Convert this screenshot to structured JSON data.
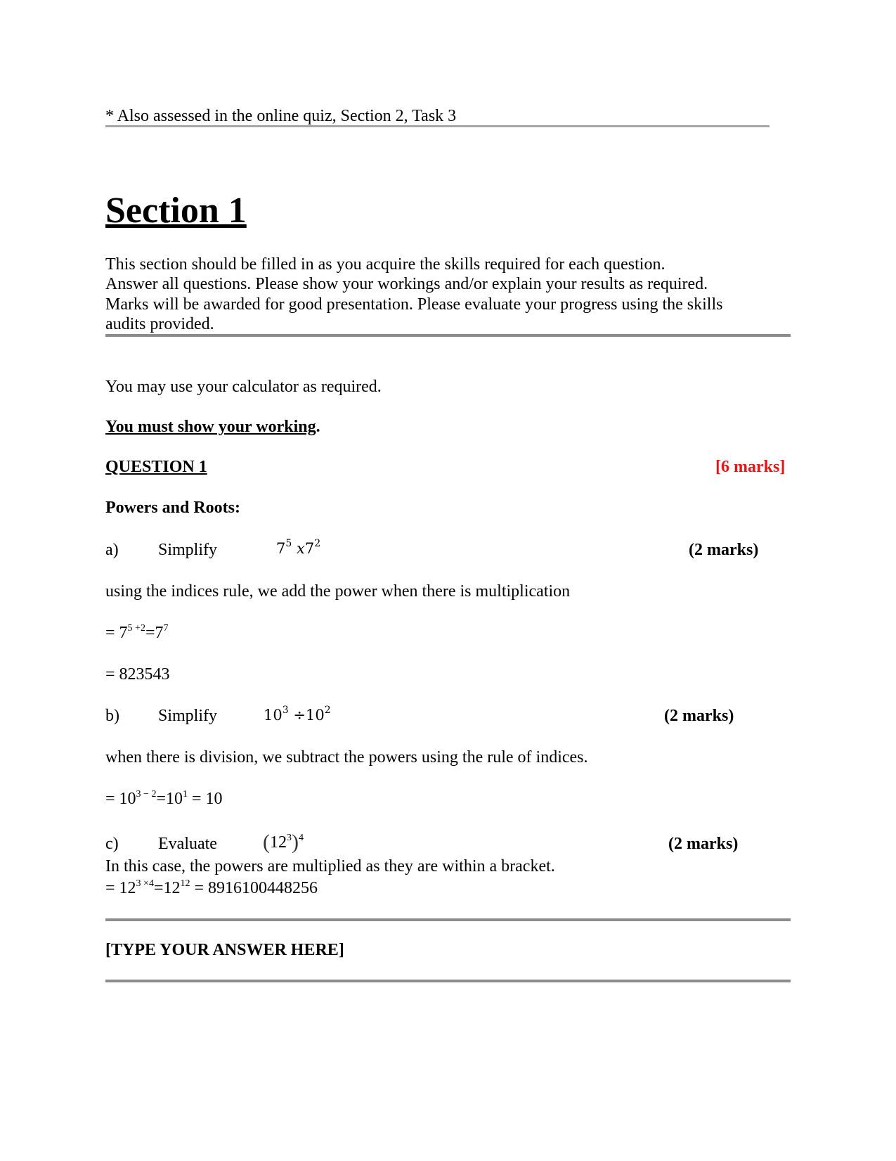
{
  "footnote": "* Also assessed in the online quiz, Section 2, Task 3",
  "section": {
    "title": "Section 1",
    "intro_lines": [
      "This section should be filled in as you acquire the skills required for each question.",
      "Answer all questions. Please show your workings and/or explain your results as required.",
      "Marks will be awarded for good presentation. Please evaluate your progress using the skills",
      "audits provided."
    ]
  },
  "calculator_note": "You may use your calculator as required.",
  "working_note": {
    "underlined": "You must show your working",
    "suffix": "."
  },
  "question": {
    "title": "QUESTION 1",
    "marks": "[6 marks]",
    "marks_color": "#ee1111",
    "topic": "Powers and Roots:",
    "parts": [
      {
        "label": "a)",
        "verb": "Simplify",
        "expr": {
          "base1": "7",
          "exp1": "5",
          "op": "x",
          "base2": "7",
          "exp2": "2"
        },
        "marks": "(2 marks)",
        "explanation": "using the indices rule, we add the power when there is multiplication",
        "step1": {
          "prefix": "= 7",
          "exp": "5 +2",
          "mid": "=7",
          "exp2": "7"
        },
        "step2": "= 823543"
      },
      {
        "label": "b)",
        "verb": "Simplify",
        "expr": {
          "base1": "10",
          "exp1": "3",
          "op": "÷",
          "base2": "10",
          "exp2": "2"
        },
        "marks": "(2 marks)",
        "explanation": "when there is division, we subtract the powers using the rule of indices.",
        "step1": {
          "prefix": "= 10",
          "exp": "3 − 2",
          "mid": "=10",
          "exp2": "1",
          "suffix": " = 10"
        }
      },
      {
        "label": "c)",
        "verb": "Evaluate",
        "expr": {
          "open": "(",
          "base": "12",
          "inner_exp": "3",
          "close": ")",
          "outer_exp": "4"
        },
        "marks": "(2 marks)",
        "explanation": "In this case, the powers are multiplied as they are within a bracket.",
        "step1": {
          "prefix": "= 12",
          "exp": "3 ×4",
          "mid": "=12",
          "exp2": "12",
          "suffix": " = 8916100448256"
        }
      }
    ]
  },
  "answer_placeholder": "[TYPE YOUR ANSWER HERE]"
}
